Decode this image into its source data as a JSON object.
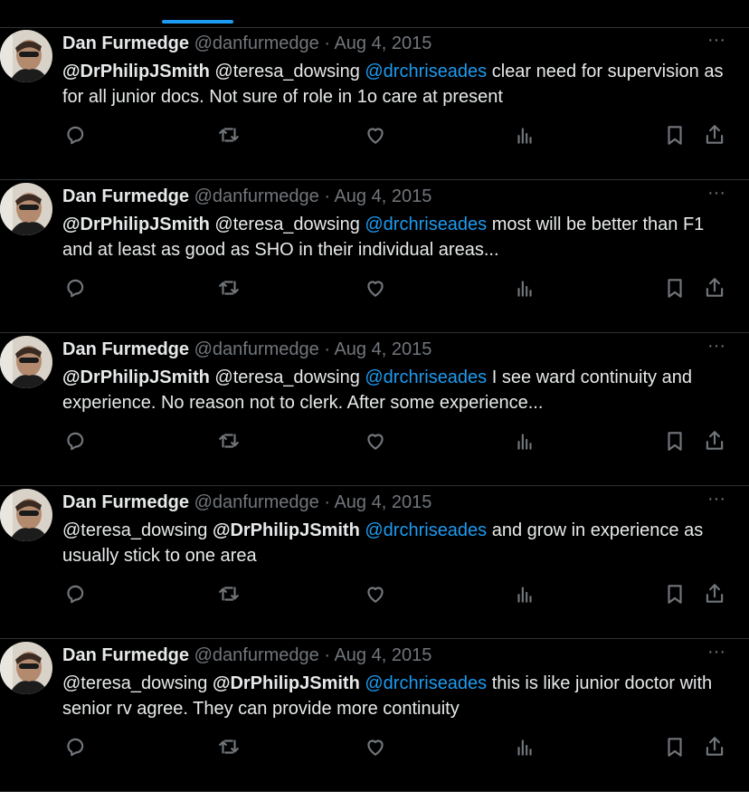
{
  "tweets": [
    {
      "author": "Dan Furmedge",
      "handle": "@danfurmedge",
      "separator": "·",
      "date": "Aug 4, 2015",
      "more": "···",
      "mention1": "@DrPhilipJSmith",
      "mention2": "@teresa_dowsing",
      "mention3": "@drchriseades",
      "text": " clear need for supervision as for all junior docs. Not sure of role in 1o care at present"
    },
    {
      "author": "Dan Furmedge",
      "handle": "@danfurmedge",
      "separator": "·",
      "date": "Aug 4, 2015",
      "more": "···",
      "mention1": "@DrPhilipJSmith",
      "mention2": "@teresa_dowsing",
      "mention3": "@drchriseades",
      "text": " most will be better than F1 and at least as good as SHO in their individual areas..."
    },
    {
      "author": "Dan Furmedge",
      "handle": "@danfurmedge",
      "separator": "·",
      "date": "Aug 4, 2015",
      "more": "···",
      "mention1": "@DrPhilipJSmith",
      "mention2": "@teresa_dowsing",
      "mention3": "@drchriseades",
      "text": " I see ward continuity and experience. No reason not to clerk. After some experience..."
    },
    {
      "author": "Dan Furmedge",
      "handle": "@danfurmedge",
      "separator": "·",
      "date": "Aug 4, 2015",
      "more": "···",
      "mention1": "@teresa_dowsing",
      "mention2": "@DrPhilipJSmith",
      "mention3": "@drchriseades",
      "text": " and grow in experience as usually stick to one area"
    },
    {
      "author": "Dan Furmedge",
      "handle": "@danfurmedge",
      "separator": "·",
      "date": "Aug 4, 2015",
      "more": "···",
      "mention1": "@teresa_dowsing",
      "mention2": "@DrPhilipJSmith",
      "mention3": "@drchriseades",
      "text": " this is like junior doctor with senior rv agree. They can provide more continuity"
    }
  ],
  "icons": {
    "reply": "reply-icon",
    "retweet": "retweet-icon",
    "like": "heart-icon",
    "views": "views-icon",
    "bookmark": "bookmark-icon",
    "share": "share-icon"
  },
  "colors": {
    "background": "#000000",
    "text": "#e7e9ea",
    "muted": "#71767b",
    "link": "#1d9bf0",
    "divider": "#2f3336"
  }
}
